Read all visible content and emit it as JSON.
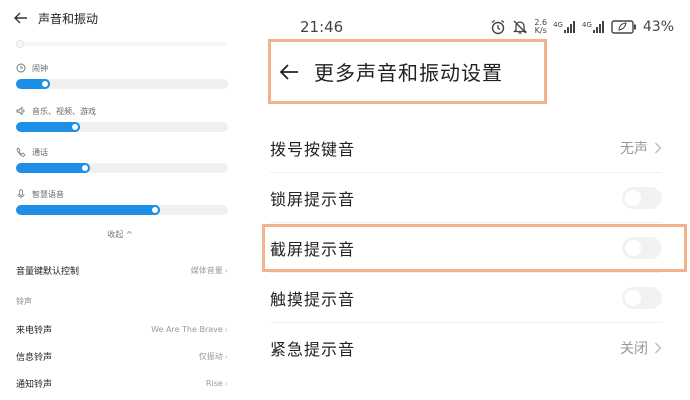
{
  "left": {
    "title": "声音和振动",
    "volumes": [
      {
        "label": "闹钟",
        "icon": "clock-icon",
        "level": 0.16
      },
      {
        "label": "音乐、视频、游戏",
        "icon": "speaker-icon",
        "level": 0.3
      },
      {
        "label": "通话",
        "icon": "phone-icon",
        "level": 0.35
      },
      {
        "label": "智慧语音",
        "icon": "microphone-icon",
        "level": 0.68
      }
    ],
    "collapse_label": "收起 ^",
    "rows": [
      {
        "title": "音量键默认控制",
        "value": "媒体音量"
      }
    ],
    "section": "铃声",
    "ringtones": [
      {
        "title": "来电铃声",
        "value": "We Are The Brave"
      },
      {
        "title": "信息铃声",
        "value": "仅振动"
      },
      {
        "title": "通知铃声",
        "value": "Rise"
      }
    ]
  },
  "status": {
    "time": "21:46",
    "speed_top": "2.6",
    "speed_bottom": "K/s",
    "net1": "4G",
    "net2": "4G",
    "battery": "43%"
  },
  "right": {
    "title": "更多声音和振动设置",
    "settings": [
      {
        "label": "拨号按键音",
        "type": "value",
        "value": "无声"
      },
      {
        "label": "锁屏提示音",
        "type": "toggle",
        "on": false
      },
      {
        "label": "截屏提示音",
        "type": "toggle",
        "on": false
      },
      {
        "label": "触摸提示音",
        "type": "toggle",
        "on": false
      },
      {
        "label": "紧急提示音",
        "type": "value",
        "value": "关闭"
      }
    ]
  },
  "colors": {
    "accent": "#1e8fe6",
    "highlight": "#f2b38c"
  }
}
